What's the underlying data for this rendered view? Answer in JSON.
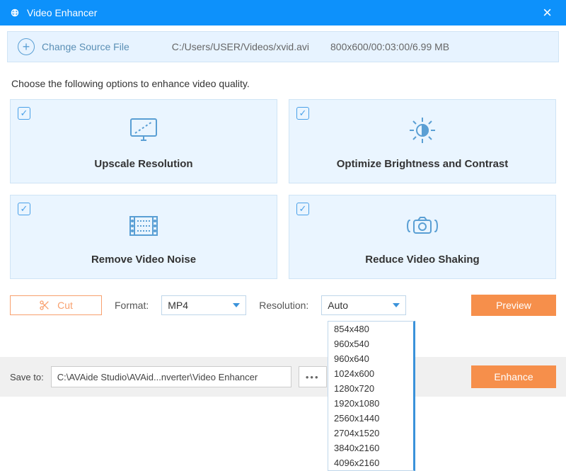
{
  "title": "Video Enhancer",
  "toolbar": {
    "change_source": "Change Source File",
    "filepath": "C:/Users/USER/Videos/xvid.avi",
    "fileinfo": "800x600/00:03:00/6.99 MB"
  },
  "instruction": "Choose the following options to enhance video quality.",
  "options": {
    "upscale": "Upscale Resolution",
    "brightness": "Optimize Brightness and Contrast",
    "noise": "Remove Video Noise",
    "shaking": "Reduce Video Shaking"
  },
  "controls": {
    "cut": "Cut",
    "format_label": "Format:",
    "format_value": "MP4",
    "resolution_label": "Resolution:",
    "resolution_value": "Auto",
    "preview": "Preview"
  },
  "dropdown": {
    "r0": "854x480",
    "r1": "960x540",
    "r2": "960x640",
    "r3": "1024x600",
    "r4": "1280x720",
    "r5": "1920x1080",
    "r6": "2560x1440",
    "r7": "2704x1520",
    "r8": "3840x2160",
    "r9": "4096x2160"
  },
  "save": {
    "label": "Save to:",
    "path": "C:\\AVAide Studio\\AVAid...nverter\\Video Enhancer",
    "enhance": "Enhance"
  }
}
